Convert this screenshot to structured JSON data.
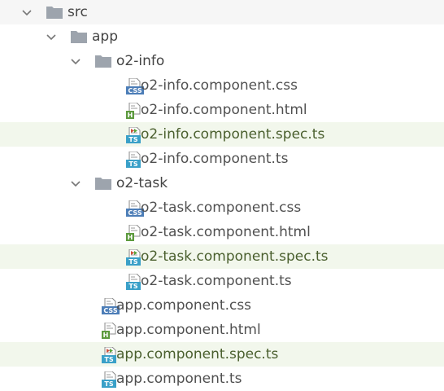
{
  "colors": {
    "folder_icon": "#9da4ad",
    "css_badge": "#4c7db7",
    "html_badge": "#5d9a3e",
    "ts_badge": "#3aa0c8",
    "spec_row_bg": "#f2f7ec"
  },
  "tree": [
    {
      "type": "folder",
      "label": "src",
      "depth": 0,
      "expanded": true
    },
    {
      "type": "folder",
      "label": "app",
      "depth": 1,
      "expanded": true
    },
    {
      "type": "folder",
      "label": "o2-info",
      "depth": 2,
      "expanded": true
    },
    {
      "type": "css",
      "label": "o2-info.component.css",
      "depth": 3,
      "badge": "CSS"
    },
    {
      "type": "html",
      "label": "o2-info.component.html",
      "depth": 3,
      "badge": "H"
    },
    {
      "type": "spec",
      "label": "o2-info.component.spec.ts",
      "depth": 3,
      "badge": "TS",
      "highlight": true
    },
    {
      "type": "ts",
      "label": "o2-info.component.ts",
      "depth": 3,
      "badge": "TS"
    },
    {
      "type": "folder",
      "label": "o2-task",
      "depth": 2,
      "expanded": true
    },
    {
      "type": "css",
      "label": "o2-task.component.css",
      "depth": 3,
      "badge": "CSS"
    },
    {
      "type": "html",
      "label": "o2-task.component.html",
      "depth": 3,
      "badge": "H"
    },
    {
      "type": "spec",
      "label": "o2-task.component.spec.ts",
      "depth": 3,
      "badge": "TS",
      "highlight": true
    },
    {
      "type": "ts",
      "label": "o2-task.component.ts",
      "depth": 3,
      "badge": "TS"
    },
    {
      "type": "css",
      "label": "app.component.css",
      "depth": 2,
      "badge": "CSS"
    },
    {
      "type": "html",
      "label": "app.component.html",
      "depth": 2,
      "badge": "H"
    },
    {
      "type": "spec",
      "label": "app.component.spec.ts",
      "depth": 2,
      "badge": "TS",
      "highlight": true
    },
    {
      "type": "ts",
      "label": "app.component.ts",
      "depth": 2,
      "badge": "TS"
    }
  ]
}
